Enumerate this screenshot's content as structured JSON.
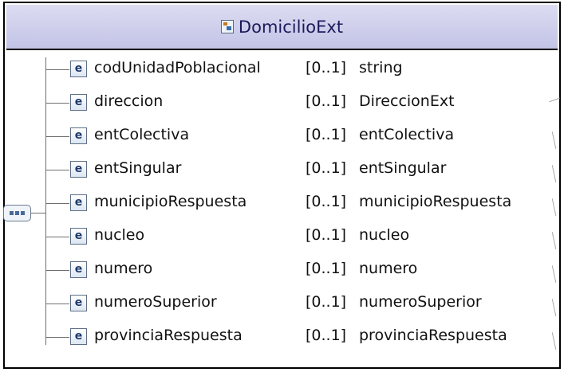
{
  "diagram": {
    "title": "DomicilioExt",
    "elements": [
      {
        "icon": "e",
        "name": "codUnidadPoblacional",
        "cardinality": "[0..1]",
        "type": "string"
      },
      {
        "icon": "e",
        "name": "direccion",
        "cardinality": "[0..1]",
        "type": "DireccionExt"
      },
      {
        "icon": "e",
        "name": "entColectiva",
        "cardinality": "[0..1]",
        "type": "entColectiva"
      },
      {
        "icon": "e",
        "name": "entSingular",
        "cardinality": "[0..1]",
        "type": "entSingular"
      },
      {
        "icon": "e",
        "name": "municipioRespuesta",
        "cardinality": "[0..1]",
        "type": "municipioRespuesta"
      },
      {
        "icon": "e",
        "name": "nucleo",
        "cardinality": "[0..1]",
        "type": "nucleo"
      },
      {
        "icon": "e",
        "name": "numero",
        "cardinality": "[0..1]",
        "type": "numero"
      },
      {
        "icon": "e",
        "name": "numeroSuperior",
        "cardinality": "[0..1]",
        "type": "numeroSuperior"
      },
      {
        "icon": "e",
        "name": "provinciaRespuesta",
        "cardinality": "[0..1]",
        "type": "provinciaRespuesta"
      }
    ]
  },
  "icons": {
    "header": "complex-type-icon",
    "element": "element-icon",
    "sequence": "sequence-compositor-icon"
  },
  "colors": {
    "header_background": "#c3c3e6",
    "border": "#000000",
    "element_icon": "#1f3a6a"
  }
}
